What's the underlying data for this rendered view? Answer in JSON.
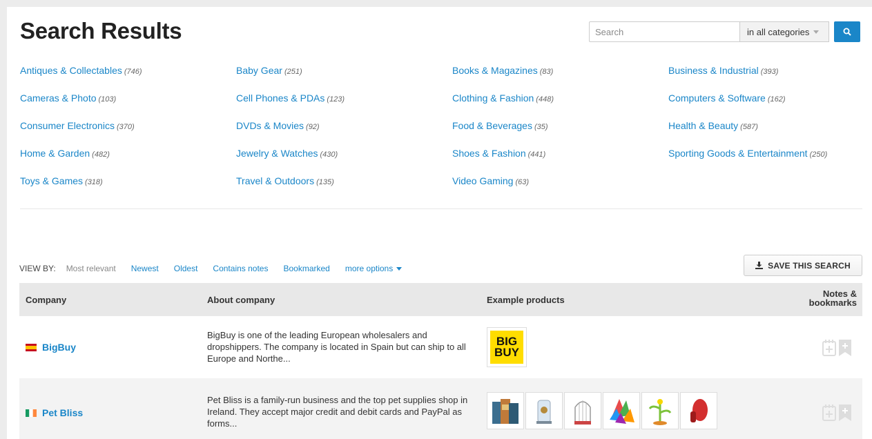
{
  "page": {
    "title": "Search Results"
  },
  "search": {
    "placeholder": "Search",
    "category": "in all categories"
  },
  "categories": [
    {
      "name": "Antiques & Collectables",
      "count": "(746)"
    },
    {
      "name": "Baby Gear",
      "count": "(251)"
    },
    {
      "name": "Books & Magazines",
      "count": "(83)"
    },
    {
      "name": "Business & Industrial",
      "count": "(393)"
    },
    {
      "name": "Cameras & Photo",
      "count": "(103)"
    },
    {
      "name": "Cell Phones & PDAs",
      "count": "(123)"
    },
    {
      "name": "Clothing & Fashion",
      "count": "(448)"
    },
    {
      "name": "Computers & Software",
      "count": "(162)"
    },
    {
      "name": "Consumer Electronics",
      "count": "(370)"
    },
    {
      "name": "DVDs & Movies",
      "count": "(92)"
    },
    {
      "name": "Food & Beverages",
      "count": "(35)"
    },
    {
      "name": "Health & Beauty",
      "count": "(587)"
    },
    {
      "name": "Home & Garden",
      "count": "(482)"
    },
    {
      "name": "Jewelry & Watches",
      "count": "(430)"
    },
    {
      "name": "Shoes & Fashion",
      "count": "(441)"
    },
    {
      "name": "Sporting Goods & Entertainment",
      "count": "(250)"
    },
    {
      "name": "Toys & Games",
      "count": "(318)"
    },
    {
      "name": "Travel & Outdoors",
      "count": "(135)"
    },
    {
      "name": "Video Gaming",
      "count": "(63)"
    }
  ],
  "viewby": {
    "label": "VIEW BY:",
    "options": [
      "Most relevant",
      "Newest",
      "Oldest",
      "Contains notes",
      "Bookmarked",
      "more options"
    ]
  },
  "save_button": "SAVE THIS SEARCH",
  "table": {
    "headers": {
      "company": "Company",
      "about": "About company",
      "products": "Example products",
      "notes": "Notes & bookmarks"
    },
    "rows": [
      {
        "company": "BigBuy",
        "flag": "spain-flag",
        "about": "BigBuy is one of the leading European wholesalers and dropshippers. The company is located in Spain but can ship to all Europe and Northe...",
        "logo_text": "BIG BUY"
      },
      {
        "company": "Pet Bliss",
        "flag": "ireland-flag",
        "about": "Pet Bliss is a family-run business and the top pet supplies shop in Ireland. They accept major credit and debit cards and PayPal as forms...",
        "products": [
          "pet-treats-box",
          "bird-feeder",
          "bird-cage",
          "colorful-toy",
          "plant-toy",
          "red-brush"
        ]
      }
    ]
  },
  "colors": {
    "accent": "#1a86c8",
    "header_bg": "#e8e8e8"
  }
}
